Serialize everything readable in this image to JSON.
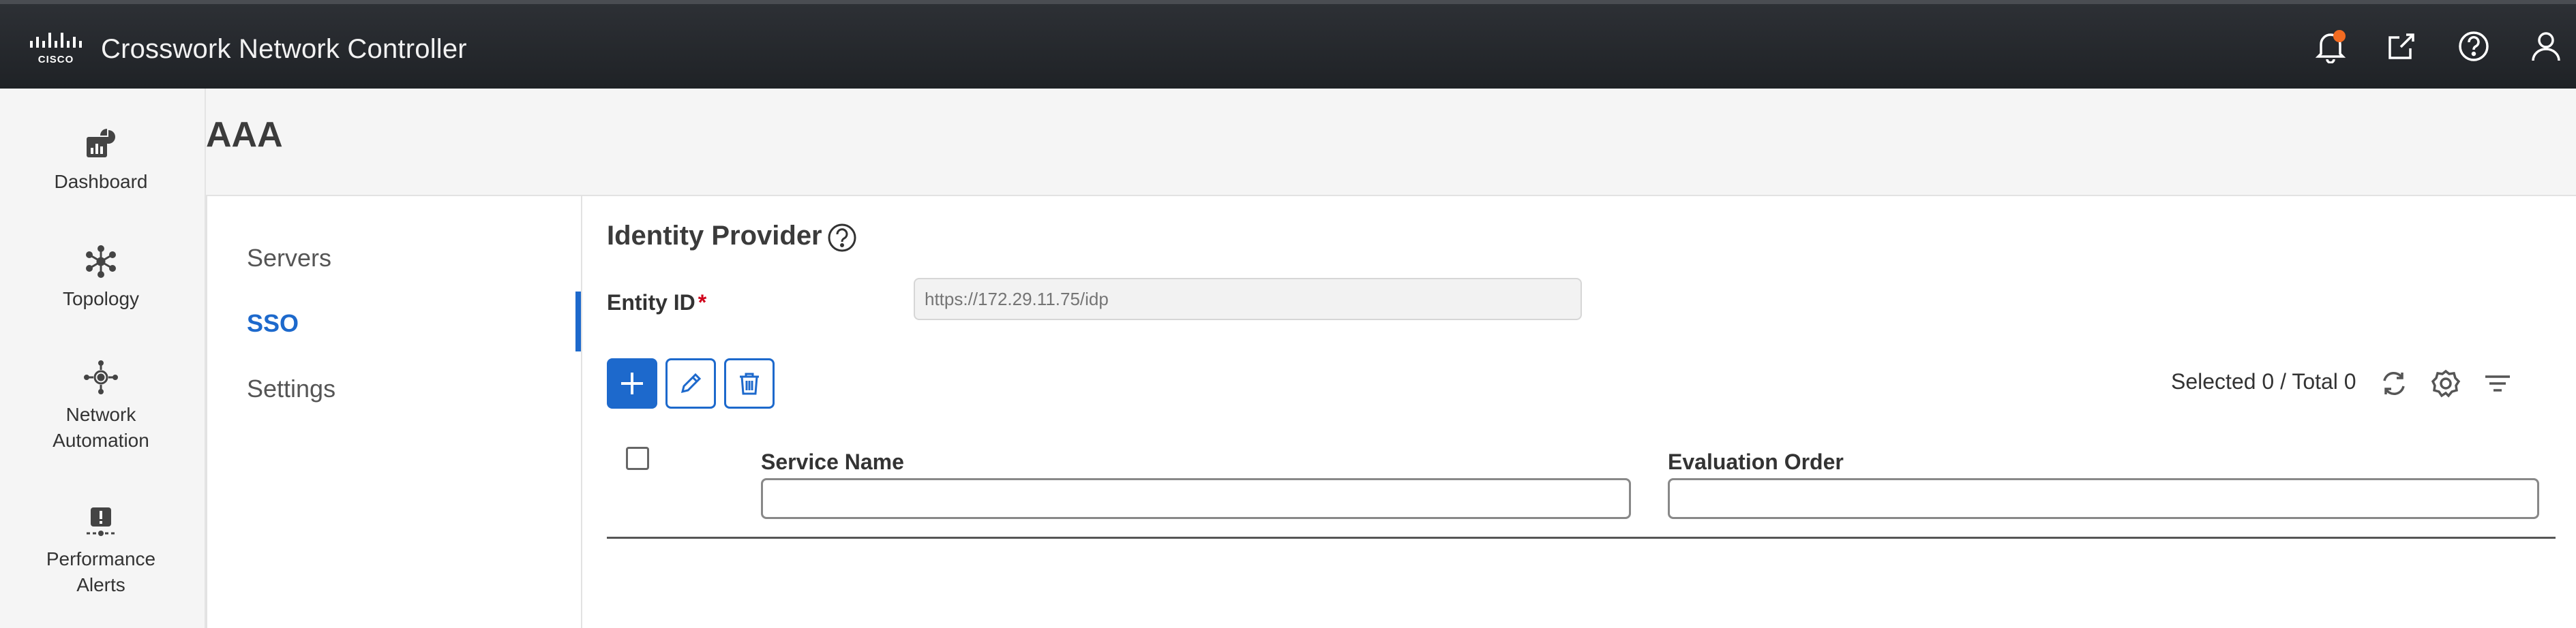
{
  "header": {
    "brand_logo": "cisco-logo",
    "app_title": "Crosswork Network Controller",
    "icons": [
      "bell-icon",
      "external-link-icon",
      "help-icon",
      "user-icon"
    ],
    "notification_dot_color": "#f36b21"
  },
  "leftnav": {
    "items": [
      {
        "label": "Dashboard",
        "icon": "dashboard-icon"
      },
      {
        "label": "Topology",
        "icon": "topology-icon"
      },
      {
        "label": "Network\nAutomation",
        "label_line1": "Network",
        "label_line2": "Automation",
        "icon": "network-automation-icon"
      },
      {
        "label_line1": "Performance",
        "label_line2": "Alerts",
        "icon": "performance-alerts-icon"
      }
    ]
  },
  "page": {
    "title": "AAA"
  },
  "subnav": {
    "items": [
      {
        "label": "Servers",
        "active": false
      },
      {
        "label": "SSO",
        "active": true
      },
      {
        "label": "Settings",
        "active": false
      }
    ]
  },
  "identity_provider": {
    "title": "Identity Provider",
    "entity_id_label": "Entity ID",
    "required_marker": "*",
    "entity_id_placeholder": "https://172.29.11.75/idp",
    "entity_id_value": ""
  },
  "toolbar": {
    "add_icon": "plus-icon",
    "edit_icon": "pencil-icon",
    "delete_icon": "trash-icon",
    "selection_text": "Selected 0 / Total 0",
    "tools": [
      "refresh-icon",
      "settings-icon",
      "filter-icon"
    ]
  },
  "table": {
    "columns": [
      "Service Name",
      "Evaluation Order"
    ],
    "rows": []
  },
  "colors": {
    "accent": "#1d69cc",
    "topbar": "#24272b",
    "required": "#d0021b"
  }
}
